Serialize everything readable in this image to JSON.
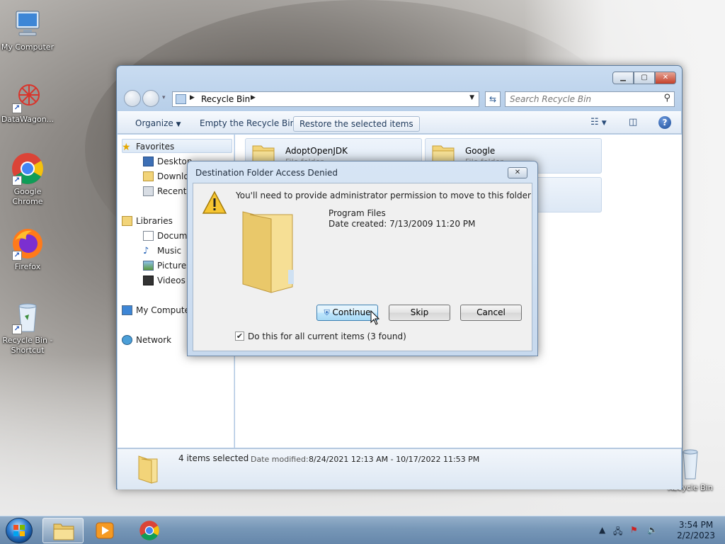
{
  "desktop": {
    "icons": [
      {
        "label": "My Computer",
        "icon": "computer-icon"
      },
      {
        "label": "DataWagon...",
        "icon": "datawagon-icon"
      },
      {
        "label": "Google Chrome",
        "icon": "chrome-icon"
      },
      {
        "label": "Firefox",
        "icon": "firefox-icon"
      },
      {
        "label": "Recycle Bin - Shortcut",
        "icon": "recycle-bin-icon"
      }
    ],
    "recycle_bin_label": "Recycle Bin"
  },
  "explorer": {
    "breadcrumb": "Recycle Bin",
    "search_placeholder": "Search Recycle Bin",
    "toolbar": {
      "organize": "Organize",
      "empty": "Empty the Recycle Bin",
      "restore": "Restore the selected items"
    },
    "nav": {
      "favorites": "Favorites",
      "desktop": "Desktop",
      "downloads": "Downloads",
      "recent": "Recent Places",
      "libraries": "Libraries",
      "documents": "Documents",
      "music": "Music",
      "pictures": "Pictures",
      "videos": "Videos",
      "computer": "My Computer",
      "network": "Network"
    },
    "items": [
      {
        "name": "AdoptOpenJDK",
        "type": "File folder"
      },
      {
        "name": "Google",
        "type": "File folder"
      }
    ],
    "details": {
      "count": "4 items selected",
      "date_label": "Date modified:",
      "date_value": "8/24/2021 12:13 AM - 10/17/2022 11:53 PM"
    }
  },
  "dialog": {
    "title": "Destination Folder Access Denied",
    "message": "You'll need to provide administrator permission to move to this folder",
    "folder_name": "Program Files",
    "date_created": "Date created: 7/13/2009 11:20 PM",
    "buttons": {
      "continue": "Continue",
      "skip": "Skip",
      "cancel": "Cancel"
    },
    "checkbox_label": "Do this for all current items (3 found)",
    "checkbox_checked": true
  },
  "taskbar": {
    "time": "3:54 PM",
    "date": "2/2/2023"
  },
  "colors": {
    "accent": "#2c7bd0",
    "folder_yellow": "#f2d479"
  }
}
